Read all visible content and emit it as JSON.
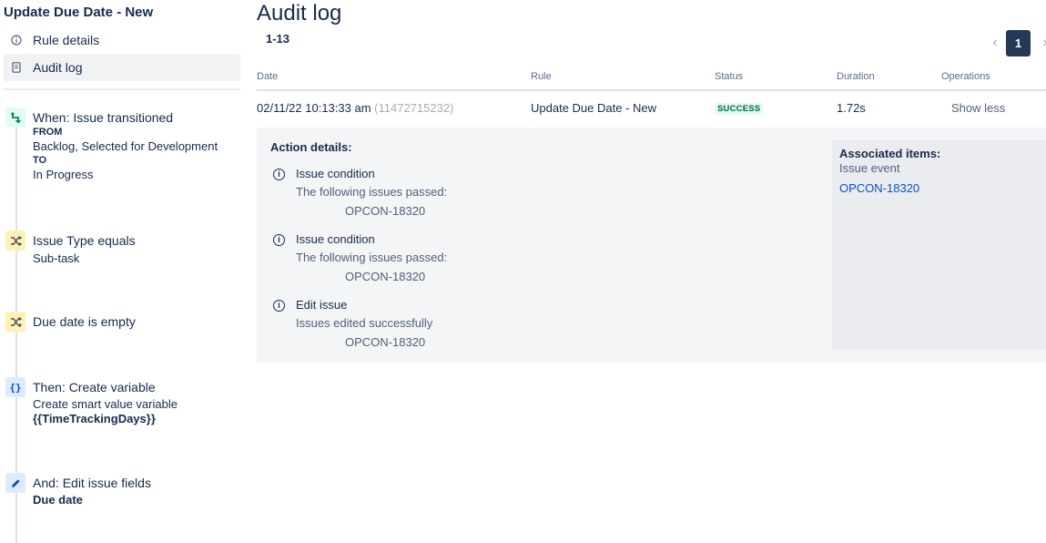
{
  "sidebar": {
    "rule_title": "Update Due Date - New",
    "nav": [
      {
        "label": "Rule details",
        "icon": "info-icon"
      },
      {
        "label": "Audit log",
        "icon": "document-icon"
      }
    ],
    "components": [
      {
        "type": "trigger",
        "icon": "transition-icon",
        "title": "When: Issue transitioned",
        "from_label": "FROM",
        "from_value": "Backlog, Selected for Development",
        "to_label": "TO",
        "to_value": "In Progress"
      },
      {
        "type": "condition",
        "icon": "shuffle-icon",
        "title": "Issue Type equals",
        "detail": "Sub-task"
      },
      {
        "type": "condition",
        "icon": "shuffle-icon",
        "title": "Due date is empty"
      },
      {
        "type": "action",
        "icon": "braces-icon",
        "title": "Then: Create variable",
        "detail": "Create smart value variable",
        "bold": "{{TimeTrackingDays}}"
      },
      {
        "type": "action",
        "icon": "pencil-icon",
        "title": "And: Edit issue fields",
        "bold": "Due date"
      }
    ]
  },
  "main": {
    "title": "Audit log",
    "range": "1-13",
    "pagination": {
      "current_page": "1",
      "prev": "‹",
      "next": "›"
    },
    "columns": [
      "Date",
      "Rule",
      "Status",
      "Duration",
      "Operations"
    ],
    "row": {
      "date": "02/11/22 10:13:33 am",
      "id": "(11472715232)",
      "rule": "Update Due Date - New",
      "status": "SUCCESS",
      "duration": "1.72s",
      "operation": "Show less"
    },
    "details": {
      "title": "Action details:",
      "items": [
        {
          "title": "Issue condition",
          "message": "The following issues passed:",
          "key": "OPCON-18320"
        },
        {
          "title": "Issue condition",
          "message": "The following issues passed:",
          "key": "OPCON-18320"
        },
        {
          "title": "Edit issue",
          "message": "Issues edited successfully",
          "key": "OPCON-18320"
        }
      ]
    },
    "associated": {
      "title": "Associated items:",
      "subtitle": "Issue event",
      "link": "OPCON-18320"
    }
  },
  "colors": {
    "success_bg": "#e3fcef",
    "success_text": "#006644",
    "link": "#0052cc",
    "pager_active": "#253858"
  }
}
